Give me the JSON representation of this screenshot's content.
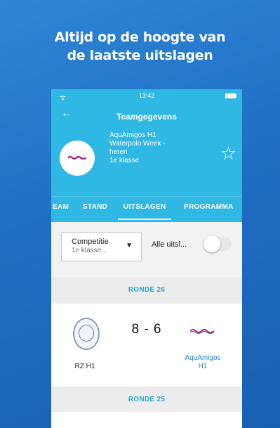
{
  "promo": {
    "headline_line1": "Altijd op de hoogte van",
    "headline_line2": "de laatste uitslagen"
  },
  "statusbar": {
    "time": "13:42",
    "wifi_icon": "wifi-icon"
  },
  "topbar": {
    "back_icon": "arrow-left-icon",
    "title": "Teamgegevens"
  },
  "team": {
    "name": "AquAmigos H1",
    "competition_line1": "Waterpolo Week -",
    "competition_line2": "heren",
    "class": "1e klasse",
    "favorite_icon": "star-outline-icon"
  },
  "tabs": [
    {
      "label": "EAM"
    },
    {
      "label": "STAND"
    },
    {
      "label": "UITSLAGEN",
      "active": true
    },
    {
      "label": "PROGRAMMA"
    }
  ],
  "filters": {
    "competition_label": "Competitie",
    "competition_value": "1e klasse...",
    "toggle_label": "Alle uitsl...",
    "toggle_on": false
  },
  "rounds": [
    {
      "label": "RONDE 26",
      "matches": [
        {
          "home": "RZ H1",
          "score": "8 - 6",
          "away_line1": "AquAmigos",
          "away_line2": "H1"
        }
      ]
    },
    {
      "label": "RONDE 25"
    }
  ],
  "colors": {
    "brand": "#2fb8e3",
    "background": "#1f6fc4",
    "link": "#2a7fd4",
    "logo_wave": "#c2186b"
  }
}
